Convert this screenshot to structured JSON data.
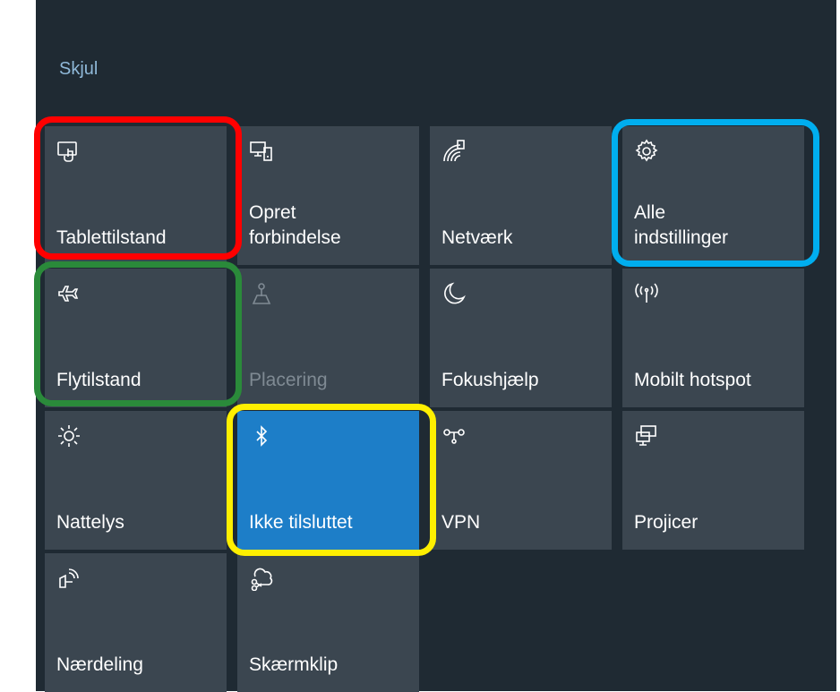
{
  "panel": {
    "hide_label": "Skjul"
  },
  "tiles": [
    {
      "label": "Tablettilstand",
      "icon": "tablet-mode-icon"
    },
    {
      "label": "Opret\nforbindelse",
      "icon": "connect-icon"
    },
    {
      "label": "Netværk",
      "icon": "network-icon"
    },
    {
      "label": "Alle\nindstillinger",
      "icon": "gear-icon"
    },
    {
      "label": "Flytilstand",
      "icon": "airplane-icon"
    },
    {
      "label": "Placering",
      "icon": "location-icon"
    },
    {
      "label": "Fokushjælp",
      "icon": "moon-icon"
    },
    {
      "label": "Mobilt hotspot",
      "icon": "hotspot-icon"
    },
    {
      "label": "Nattelys",
      "icon": "sun-icon"
    },
    {
      "label": "Ikke tilsluttet",
      "icon": "bluetooth-icon"
    },
    {
      "label": "VPN",
      "icon": "vpn-icon"
    },
    {
      "label": "Projicer",
      "icon": "project-icon"
    },
    {
      "label": "Nærdeling",
      "icon": "nearby-sharing-icon"
    },
    {
      "label": "Skærmklip",
      "icon": "snip-icon"
    }
  ],
  "colors": {
    "panel_bg": "#1f2a33",
    "tile_bg": "#3b4650",
    "tile_active": "#1d7ec8",
    "highlight_red": "#ff0000",
    "highlight_green": "#2a8a3a",
    "highlight_yellow": "#ffef00",
    "highlight_blue": "#00aeef"
  }
}
